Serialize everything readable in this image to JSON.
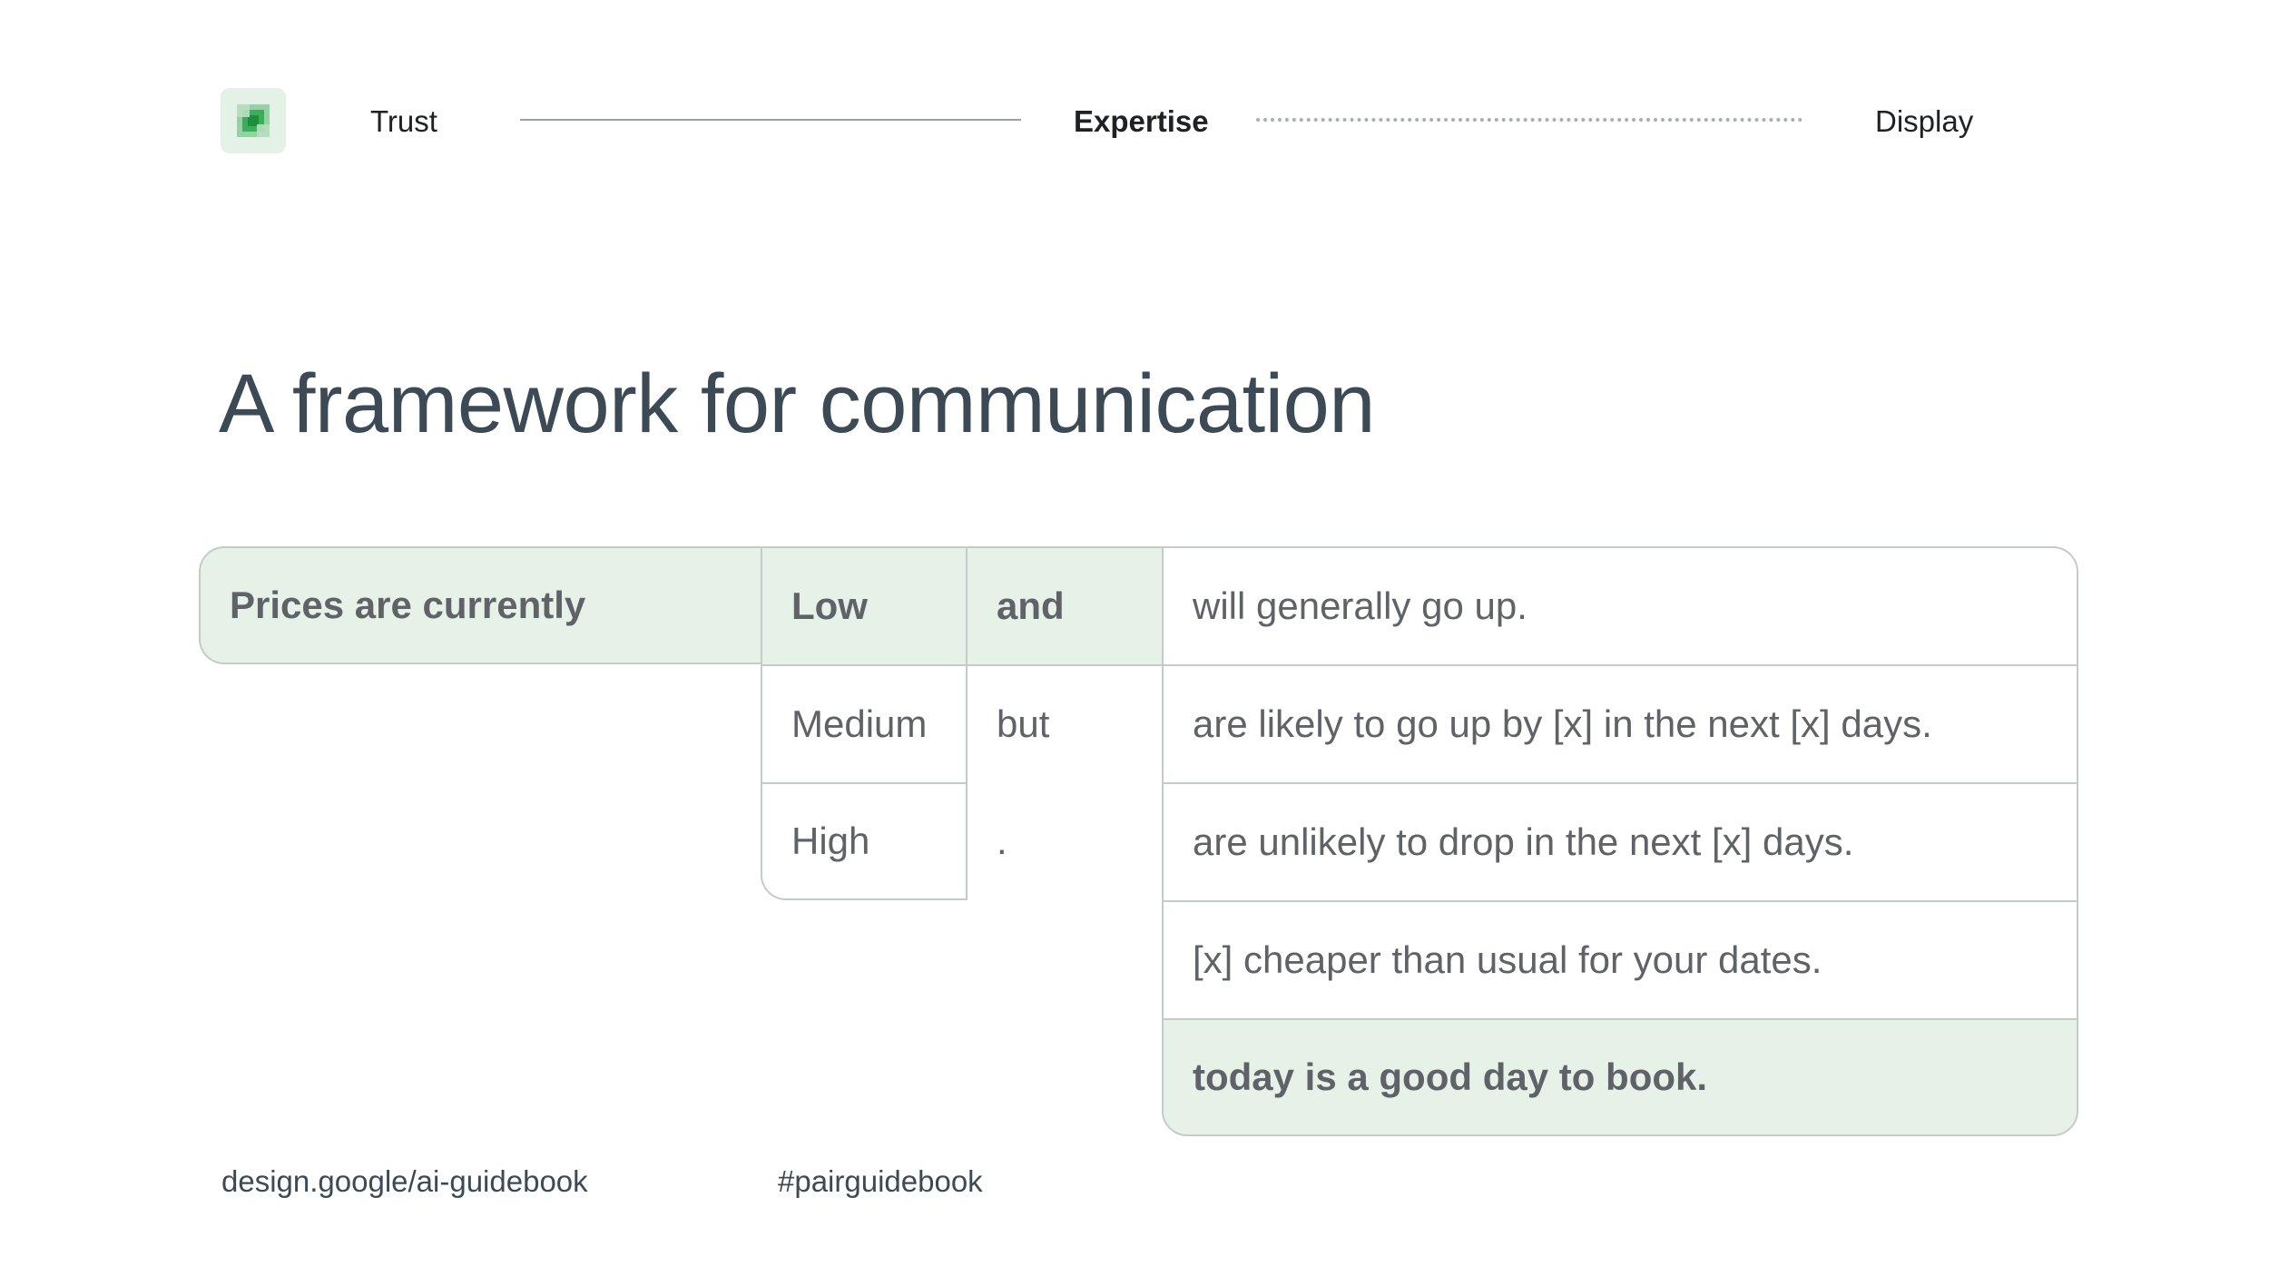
{
  "nav": {
    "steps": [
      {
        "label": "Trust",
        "state": "default"
      },
      {
        "label": "Expertise",
        "state": "active"
      },
      {
        "label": "Display",
        "state": "default"
      }
    ],
    "logo_icon": "google-pair-logo-icon"
  },
  "title": "A framework for communication",
  "framework": {
    "prefix": "Prices are currently",
    "levels": [
      "Low",
      "Medium",
      "High"
    ],
    "conjunctions": [
      "and",
      "but",
      "."
    ],
    "endings": [
      "will generally go up.",
      "are likely to go up by [x] in the next [x] days.",
      "are unlikely to drop in the next [x] days.",
      "[x] cheaper than usual for your dates.",
      "today is a good day to book."
    ],
    "highlight_color": "#e6f2e8"
  },
  "footer": {
    "url": "design.google/ai-guidebook",
    "hashtag": "#pairguidebook"
  },
  "colors": {
    "title": "#3c4a55",
    "body_text": "#5f6368",
    "border": "#c4cbc8",
    "logo_background": "#e4f1e6"
  }
}
